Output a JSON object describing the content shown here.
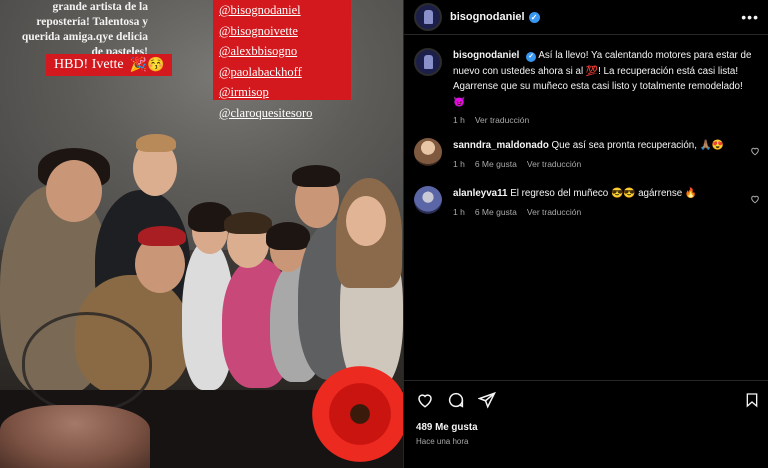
{
  "story": {
    "text": "grande artista de la repostería! Talentosa y querida amiga.qye delicia de pasteles!",
    "hbd_label": "HBD! Ivette",
    "hbd_emoji": "🎉😚",
    "tags": [
      "@bisognodaniel",
      "@bisognoivette",
      "@alexbbisogno",
      "@paolabackhoff",
      "@irmisop",
      "@claroquesitesoro"
    ]
  },
  "post": {
    "author": "bisognodaniel",
    "more_label": "•••",
    "caption": "Así la llevo! Ya calentando motores para estar de nuevo con ustedes ahora si al 💯! La recuperación está casi lista! Agarrense que su muñeco esta casi listo y totalmente remodelado! 😈",
    "caption_time": "1 h",
    "translate_label": "Ver traducción"
  },
  "comments": [
    {
      "user": "sanndra_maldonado",
      "text": "Que así sea pronta recuperación, 🙏🏽😍",
      "time": "1 h",
      "likes": "6 Me gusta",
      "translate": "Ver traducción"
    },
    {
      "user": "alanleyva11",
      "text": "El regreso del muñeco 😎😎 agárrense 🔥",
      "time": "1 h",
      "likes": "6 Me gusta",
      "translate": "Ver traducción"
    }
  ],
  "footer": {
    "likes": "489 Me gusta",
    "time": "Hace una hora"
  },
  "colors": {
    "accent_verified": "#3897f0",
    "story_red": "#d3191e",
    "muted": "#a8a8a8"
  }
}
